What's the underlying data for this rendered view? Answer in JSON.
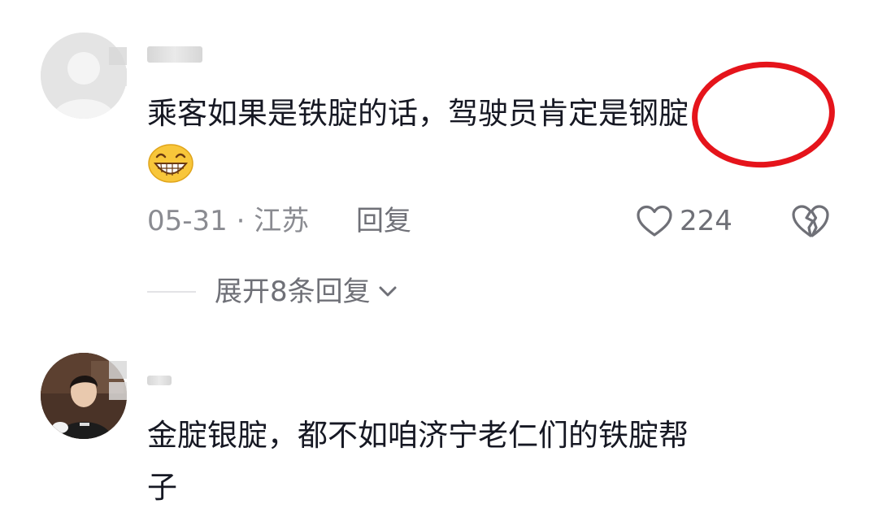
{
  "comment1": {
    "text": "乘客如果是铁腚的话，驾驶员肯定是钢腚",
    "emoji_name": "grin-emoji",
    "date_location": "05-31 · 江苏",
    "reply_label": "回复",
    "like_count": "224",
    "expand_label": "展开8条回复"
  },
  "comment2": {
    "text_line1": "金腚银腚，都不如咱济宁老仁们的铁腚帮",
    "text_line2": "子"
  },
  "colors": {
    "highlight_circle": "#e5141b",
    "meta_text": "#8a8b91",
    "body_text": "#161823"
  }
}
